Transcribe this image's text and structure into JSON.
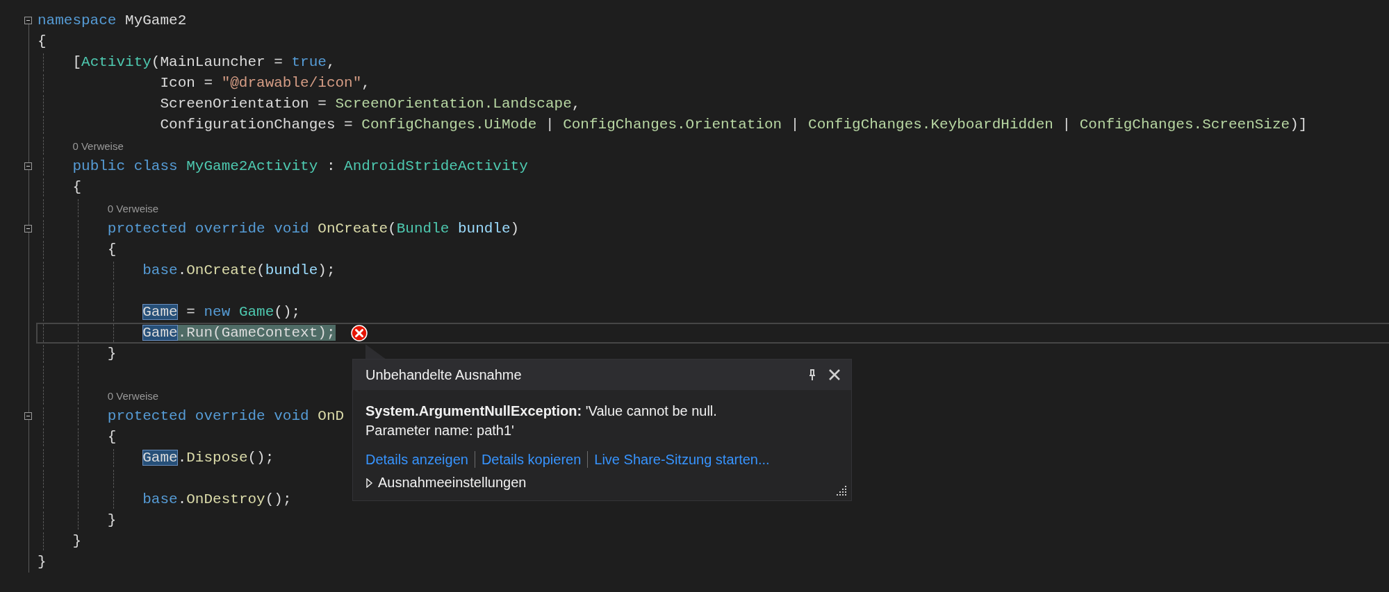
{
  "editor": {
    "lines": [
      {
        "kind": "code",
        "collapsible": true,
        "current": false,
        "error": false,
        "tokens": [
          {
            "text": "namespace ",
            "kind": "keyword"
          },
          {
            "text": "MyGame2",
            "kind": "plain"
          }
        ]
      },
      {
        "kind": "code",
        "collapsible": false,
        "current": false,
        "error": false,
        "tokens": [
          {
            "text": "{",
            "kind": "plain"
          }
        ]
      },
      {
        "kind": "code",
        "collapsible": false,
        "current": false,
        "error": false,
        "tokens": [
          {
            "text": "    [",
            "kind": "plain"
          },
          {
            "text": "Activity",
            "kind": "type"
          },
          {
            "text": "(MainLauncher = ",
            "kind": "plain"
          },
          {
            "text": "true",
            "kind": "keyword"
          },
          {
            "text": ",",
            "kind": "plain"
          }
        ]
      },
      {
        "kind": "code",
        "collapsible": false,
        "current": false,
        "error": false,
        "tokens": [
          {
            "text": "              Icon = ",
            "kind": "plain"
          },
          {
            "text": "\"@drawable/icon\"",
            "kind": "string"
          },
          {
            "text": ",",
            "kind": "plain"
          }
        ]
      },
      {
        "kind": "code",
        "collapsible": false,
        "current": false,
        "error": false,
        "tokens": [
          {
            "text": "              ScreenOrientation = ",
            "kind": "plain"
          },
          {
            "text": "ScreenOrientation.Landscape",
            "kind": "enum"
          },
          {
            "text": ",",
            "kind": "plain"
          }
        ]
      },
      {
        "kind": "code",
        "collapsible": false,
        "current": false,
        "error": false,
        "tokens": [
          {
            "text": "              ConfigurationChanges = ",
            "kind": "plain"
          },
          {
            "text": "ConfigChanges.UiMode",
            "kind": "enum"
          },
          {
            "text": " | ",
            "kind": "plain"
          },
          {
            "text": "ConfigChanges.Orientation",
            "kind": "enum"
          },
          {
            "text": " | ",
            "kind": "plain"
          },
          {
            "text": "ConfigChanges.KeyboardHidden",
            "kind": "enum"
          },
          {
            "text": " | ",
            "kind": "plain"
          },
          {
            "text": "ConfigChanges.ScreenSize",
            "kind": "enum"
          },
          {
            "text": ")]",
            "kind": "plain"
          }
        ]
      },
      {
        "kind": "codelens",
        "text": "    0 Verweise"
      },
      {
        "kind": "code",
        "collapsible": true,
        "current": false,
        "error": false,
        "tokens": [
          {
            "text": "    public class ",
            "kind": "keyword"
          },
          {
            "text": "MyGame2Activity",
            "kind": "type"
          },
          {
            "text": " : ",
            "kind": "plain"
          },
          {
            "text": "AndroidStrideActivity",
            "kind": "type"
          }
        ]
      },
      {
        "kind": "code",
        "collapsible": false,
        "current": false,
        "error": false,
        "tokens": [
          {
            "text": "    {",
            "kind": "plain"
          }
        ]
      },
      {
        "kind": "codelens",
        "text": "        0 Verweise"
      },
      {
        "kind": "code",
        "collapsible": true,
        "current": false,
        "error": false,
        "tokens": [
          {
            "text": "        protected override void ",
            "kind": "keyword"
          },
          {
            "text": "OnCreate",
            "kind": "method"
          },
          {
            "text": "(",
            "kind": "plain"
          },
          {
            "text": "Bundle",
            "kind": "type"
          },
          {
            "text": " bundle",
            "kind": "param"
          },
          {
            "text": ")",
            "kind": "plain"
          }
        ]
      },
      {
        "kind": "code",
        "collapsible": false,
        "current": false,
        "error": false,
        "tokens": [
          {
            "text": "        {",
            "kind": "plain"
          }
        ]
      },
      {
        "kind": "code",
        "collapsible": false,
        "current": false,
        "error": false,
        "tokens": [
          {
            "text": "            base",
            "kind": "keyword"
          },
          {
            "text": ".",
            "kind": "plain"
          },
          {
            "text": "OnCreate",
            "kind": "method"
          },
          {
            "text": "(",
            "kind": "plain"
          },
          {
            "text": "bundle",
            "kind": "param"
          },
          {
            "text": ");",
            "kind": "plain"
          }
        ]
      },
      {
        "kind": "blank"
      },
      {
        "kind": "code",
        "collapsible": false,
        "current": false,
        "error": false,
        "tokens": [
          {
            "text": "            Game",
            "kind": "plain",
            "highlighted": true,
            "selected": false
          },
          {
            "text": " = ",
            "kind": "plain",
            "highlighted": false,
            "selected": false
          },
          {
            "text": "new ",
            "kind": "keyword",
            "highlighted": false,
            "selected": false
          },
          {
            "text": "Game",
            "kind": "type",
            "highlighted": false,
            "selected": false
          },
          {
            "text": "();",
            "kind": "plain",
            "highlighted": false,
            "selected": false
          }
        ]
      },
      {
        "kind": "code",
        "collapsible": false,
        "current": true,
        "error": true,
        "tokens": [
          {
            "text": "            Game",
            "kind": "plain",
            "highlighted": true,
            "selected": false
          },
          {
            "text": ".Run(GameContext);",
            "kind": "plain",
            "highlighted": false,
            "selected": true
          }
        ]
      },
      {
        "kind": "code",
        "collapsible": false,
        "current": false,
        "error": false,
        "tokens": [
          {
            "text": "        }",
            "kind": "plain"
          }
        ]
      },
      {
        "kind": "blank"
      },
      {
        "kind": "codelens",
        "text": "        0 Verweise"
      },
      {
        "kind": "code",
        "collapsible": true,
        "current": false,
        "error": false,
        "tokens": [
          {
            "text": "        protected override void ",
            "kind": "keyword"
          },
          {
            "text": "OnD",
            "kind": "method"
          }
        ]
      },
      {
        "kind": "code",
        "collapsible": false,
        "current": false,
        "error": false,
        "tokens": [
          {
            "text": "        {",
            "kind": "plain"
          }
        ]
      },
      {
        "kind": "code",
        "collapsible": false,
        "current": false,
        "error": false,
        "tokens": [
          {
            "text": "            Game",
            "kind": "plain",
            "highlighted": true,
            "selected": false
          },
          {
            "text": ".",
            "kind": "plain",
            "highlighted": false,
            "selected": false
          },
          {
            "text": "Dispose",
            "kind": "method",
            "highlighted": false,
            "selected": false
          },
          {
            "text": "();",
            "kind": "plain",
            "highlighted": false,
            "selected": false
          }
        ]
      },
      {
        "kind": "blank"
      },
      {
        "kind": "code",
        "collapsible": false,
        "current": false,
        "error": false,
        "tokens": [
          {
            "text": "            base",
            "kind": "keyword"
          },
          {
            "text": ".",
            "kind": "plain"
          },
          {
            "text": "OnDestroy",
            "kind": "method"
          },
          {
            "text": "();",
            "kind": "plain"
          }
        ]
      },
      {
        "kind": "code",
        "collapsible": false,
        "current": false,
        "error": false,
        "tokens": [
          {
            "text": "        }",
            "kind": "plain"
          }
        ]
      },
      {
        "kind": "code",
        "collapsible": false,
        "current": false,
        "error": false,
        "tokens": [
          {
            "text": "    }",
            "kind": "plain"
          }
        ]
      },
      {
        "kind": "code",
        "collapsible": false,
        "current": false,
        "error": false,
        "tokens": [
          {
            "text": "}",
            "kind": "plain"
          }
        ]
      }
    ]
  },
  "exception_popup": {
    "title": "Unbehandelte Ausnahme",
    "message": "**System.ArgumentNullException:** 'Value cannot be null.\nParameter name: path1'",
    "links": [
      "Details anzeigen",
      "Details kopieren",
      "Live Share-Sitzung starten..."
    ],
    "settings": {
      "label": "Ausnahmeeinstellungen",
      "expanded": false
    }
  }
}
